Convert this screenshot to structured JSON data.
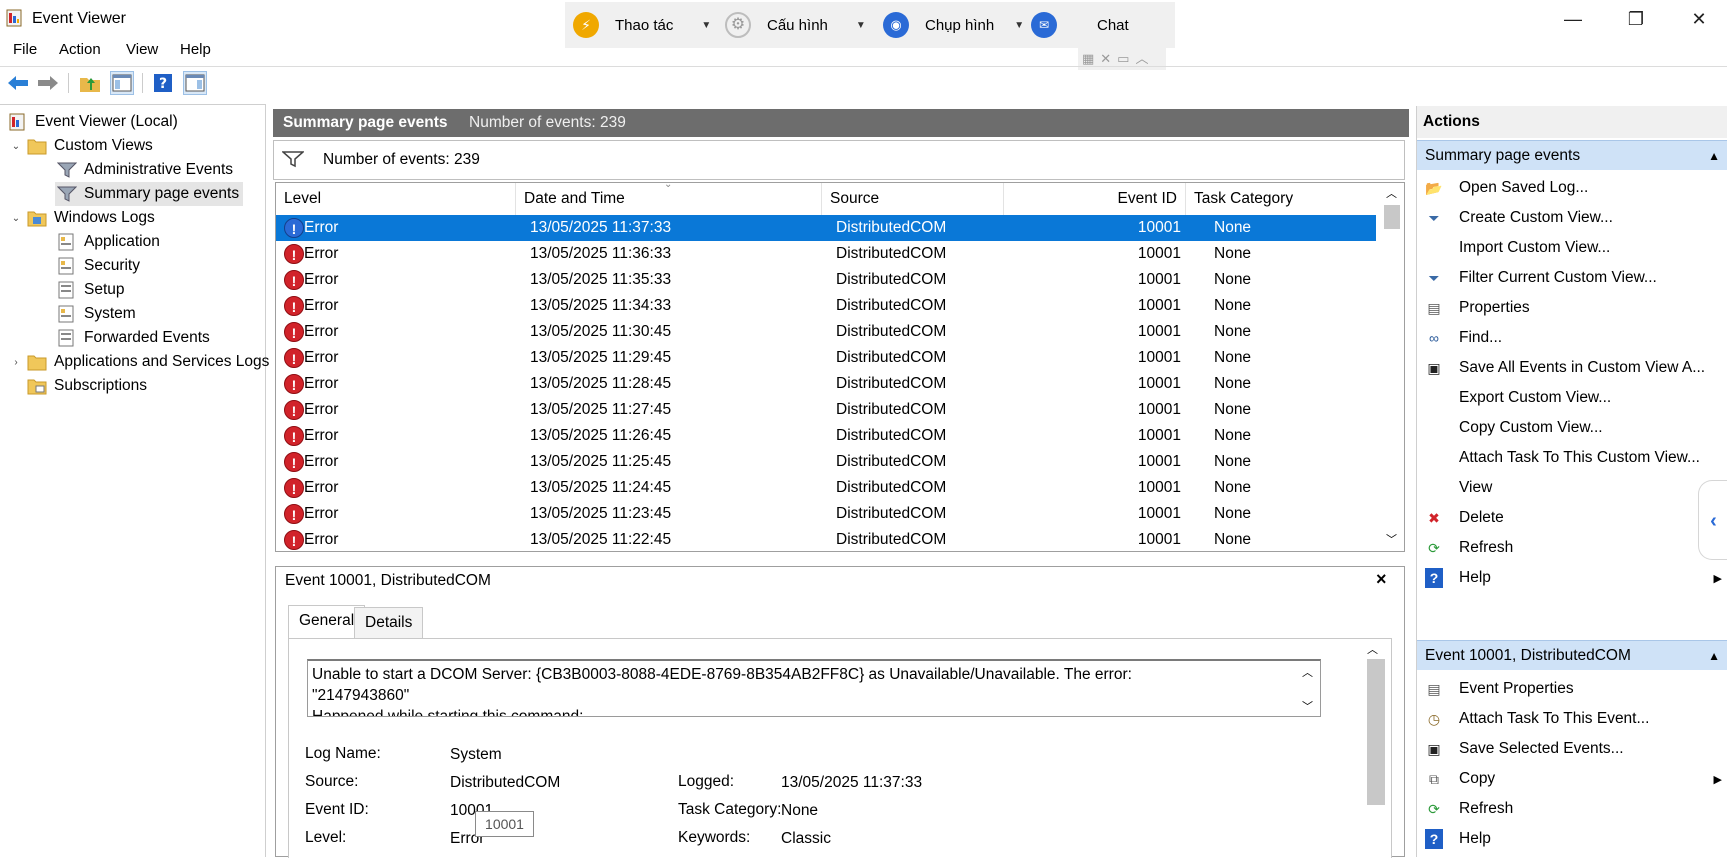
{
  "window": {
    "title": "Event Viewer",
    "minimize": "—",
    "restore": "❐",
    "close": "✕"
  },
  "remote_toolbar": {
    "items": [
      {
        "label": "Thao tác",
        "icon": "lightning-icon",
        "color": "#f0a800"
      },
      {
        "label": "Cấu hình",
        "icon": "gear-icon",
        "color": "#bdbdbd"
      },
      {
        "label": "Chụp hình",
        "icon": "camera-icon",
        "color": "#2a6ad6"
      },
      {
        "label": "Chat",
        "icon": "chat-icon",
        "color": "#2a6ad6"
      }
    ]
  },
  "menu": [
    "File",
    "Action",
    "View",
    "Help"
  ],
  "tree": {
    "root": "Event Viewer (Local)",
    "custom_views": "Custom Views",
    "administrative_events": "Administrative Events",
    "summary_page_events": "Summary page events",
    "windows_logs": "Windows Logs",
    "application": "Application",
    "security": "Security",
    "setup": "Setup",
    "system": "System",
    "forwarded_events": "Forwarded Events",
    "apps_services": "Applications and Services Logs",
    "subscriptions": "Subscriptions"
  },
  "center": {
    "header_title": "Summary page events",
    "header_count": "Number of events: 239",
    "filter_count": "Number of events: 239",
    "columns": [
      "Level",
      "Date and Time",
      "Source",
      "Event ID",
      "Task Category"
    ],
    "rows": [
      {
        "level": "Error",
        "datetime": "13/05/2025 11:37:33",
        "source": "DistributedCOM",
        "event_id": "10001",
        "category": "None"
      },
      {
        "level": "Error",
        "datetime": "13/05/2025 11:36:33",
        "source": "DistributedCOM",
        "event_id": "10001",
        "category": "None"
      },
      {
        "level": "Error",
        "datetime": "13/05/2025 11:35:33",
        "source": "DistributedCOM",
        "event_id": "10001",
        "category": "None"
      },
      {
        "level": "Error",
        "datetime": "13/05/2025 11:34:33",
        "source": "DistributedCOM",
        "event_id": "10001",
        "category": "None"
      },
      {
        "level": "Error",
        "datetime": "13/05/2025 11:30:45",
        "source": "DistributedCOM",
        "event_id": "10001",
        "category": "None"
      },
      {
        "level": "Error",
        "datetime": "13/05/2025 11:29:45",
        "source": "DistributedCOM",
        "event_id": "10001",
        "category": "None"
      },
      {
        "level": "Error",
        "datetime": "13/05/2025 11:28:45",
        "source": "DistributedCOM",
        "event_id": "10001",
        "category": "None"
      },
      {
        "level": "Error",
        "datetime": "13/05/2025 11:27:45",
        "source": "DistributedCOM",
        "event_id": "10001",
        "category": "None"
      },
      {
        "level": "Error",
        "datetime": "13/05/2025 11:26:45",
        "source": "DistributedCOM",
        "event_id": "10001",
        "category": "None"
      },
      {
        "level": "Error",
        "datetime": "13/05/2025 11:25:45",
        "source": "DistributedCOM",
        "event_id": "10001",
        "category": "None"
      },
      {
        "level": "Error",
        "datetime": "13/05/2025 11:24:45",
        "source": "DistributedCOM",
        "event_id": "10001",
        "category": "None"
      },
      {
        "level": "Error",
        "datetime": "13/05/2025 11:23:45",
        "source": "DistributedCOM",
        "event_id": "10001",
        "category": "None"
      },
      {
        "level": "Error",
        "datetime": "13/05/2025 11:22:45",
        "source": "DistributedCOM",
        "event_id": "10001",
        "category": "None"
      }
    ],
    "selected_index": 0
  },
  "detail": {
    "title": "Event 10001, DistributedCOM",
    "close": "×",
    "tabs": [
      "General",
      "Details"
    ],
    "message_line1": "Unable to start a DCOM Server: {CB3B0003-8088-4EDE-8769-8B354AB2FF8C} as Unavailable/Unavailable. The error:",
    "message_line2": "\"2147943860\"",
    "message_line3": "Happened while starting this command:",
    "fields": {
      "log_name_label": "Log Name:",
      "log_name": "System",
      "source_label": "Source:",
      "source": "DistributedCOM",
      "logged_label": "Logged:",
      "logged": "13/05/2025 11:37:33",
      "event_id_label": "Event ID:",
      "event_id": "10001",
      "task_category_label": "Task Category:",
      "task_category": "None",
      "level_label": "Level:",
      "level": "Error",
      "keywords_label": "Keywords:",
      "keywords": "Classic"
    },
    "tooltip": "10001"
  },
  "actions": {
    "title": "Actions",
    "section1": "Summary page events",
    "items1": [
      {
        "label": "Open Saved Log...",
        "icon": "folder-open-icon"
      },
      {
        "label": "Create Custom View...",
        "icon": "filter-icon"
      },
      {
        "label": "Import Custom View...",
        "icon": ""
      },
      {
        "label": "Filter Current Custom View...",
        "icon": "filter-icon"
      },
      {
        "label": "Properties",
        "icon": "properties-icon"
      },
      {
        "label": "Find...",
        "icon": "binoculars-icon"
      },
      {
        "label": "Save All Events in Custom View A...",
        "icon": "save-icon"
      },
      {
        "label": "Export Custom View...",
        "icon": ""
      },
      {
        "label": "Copy Custom View...",
        "icon": ""
      },
      {
        "label": "Attach Task To This Custom View...",
        "icon": ""
      },
      {
        "label": "View",
        "icon": ""
      },
      {
        "label": "Delete",
        "icon": "delete-icon"
      },
      {
        "label": "Refresh",
        "icon": "refresh-icon"
      },
      {
        "label": "Help",
        "icon": "help-icon"
      }
    ],
    "section2": "Event 10001, DistributedCOM",
    "items2": [
      {
        "label": "Event Properties",
        "icon": "properties-icon"
      },
      {
        "label": "Attach Task To This Event...",
        "icon": "task-icon"
      },
      {
        "label": "Save Selected Events...",
        "icon": "save-icon"
      },
      {
        "label": "Copy",
        "icon": "copy-icon"
      },
      {
        "label": "Refresh",
        "icon": "refresh-icon"
      },
      {
        "label": "Help",
        "icon": "help-icon"
      }
    ]
  }
}
